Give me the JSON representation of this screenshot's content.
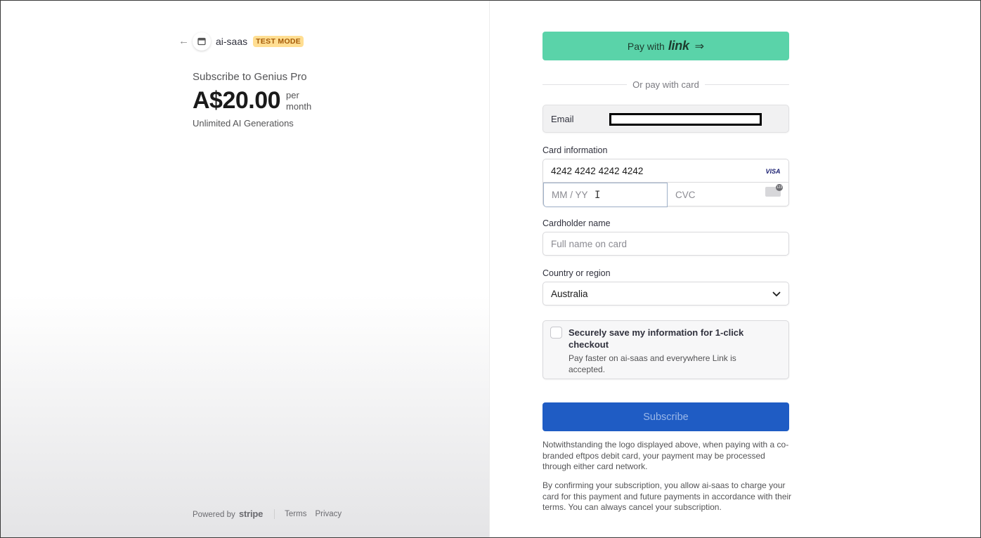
{
  "merchant": {
    "name": "ai-saas",
    "badge": "TEST MODE"
  },
  "product": {
    "title": "Subscribe to Genius Pro",
    "price": "A$20.00",
    "period_line1": "per",
    "period_line2": "month",
    "description": "Unlimited AI Generations"
  },
  "footer": {
    "powered_by": "Powered by",
    "stripe": "stripe",
    "terms": "Terms",
    "privacy": "Privacy"
  },
  "payment": {
    "link_button": {
      "prefix": "Pay with",
      "brand": "link"
    },
    "or_text": "Or pay with card",
    "email_label": "Email",
    "card_info_label": "Card information",
    "card_number": "4242 4242 4242 4242",
    "card_brand": "VISA",
    "expiry_placeholder": "MM / YY",
    "cvc_placeholder": "CVC",
    "cardholder_label": "Cardholder name",
    "cardholder_placeholder": "Full name on card",
    "country_label": "Country or region",
    "country_value": "Australia",
    "save": {
      "title": "Securely save my information for 1-click checkout",
      "subtitle": "Pay faster on ai-saas and everywhere Link is accepted."
    },
    "subscribe_label": "Subscribe",
    "legal_1": "Notwithstanding the logo displayed above, when paying with a co-branded eftpos debit card, your payment may be processed through either card network.",
    "legal_2": "By confirming your subscription, you allow ai-saas to charge your card for this payment and future payments in accordance with their terms. You can always cancel your subscription."
  },
  "colors": {
    "link_green": "#5ad3a9",
    "subscribe_blue": "#1f5cc4",
    "test_badge_bg": "#ffde92",
    "test_badge_text": "#a55b08"
  }
}
